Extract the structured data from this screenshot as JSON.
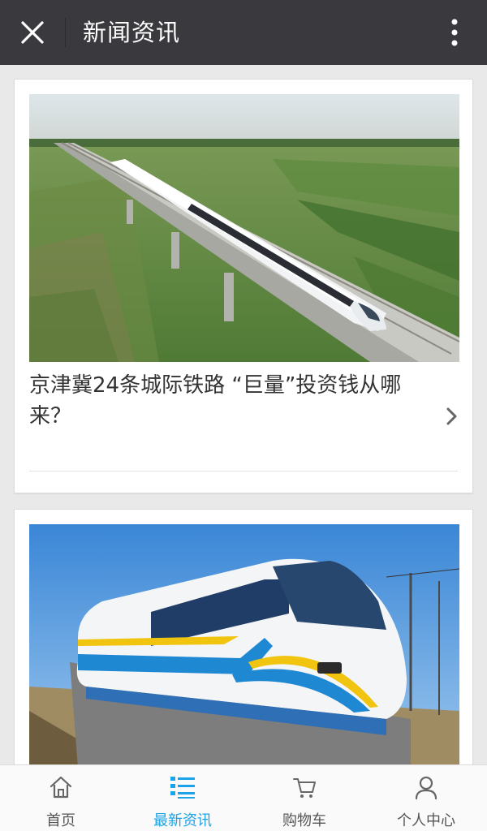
{
  "header": {
    "title": "新闻资讯",
    "close_icon": "close-icon",
    "more_icon": "more-vertical-icon"
  },
  "articles": [
    {
      "title": "京津冀24条城际铁路 “巨量”投资钱从哪来？",
      "image": "high-speed-train-on-viaduct-photo",
      "arrow_icon": "chevron-right-icon"
    },
    {
      "title": "",
      "image": "maglev-train-photo"
    }
  ],
  "tabs": [
    {
      "label": "首页",
      "icon": "home-icon",
      "active": false
    },
    {
      "label": "最新资讯",
      "icon": "news-list-icon",
      "active": true
    },
    {
      "label": "购物车",
      "icon": "cart-icon",
      "active": false
    },
    {
      "label": "个人中心",
      "icon": "user-icon",
      "active": false
    }
  ],
  "colors": {
    "header_bg": "#3a3a3e",
    "page_bg": "#e9e9e9",
    "accent": "#1aa3e8",
    "tab_text": "#555555"
  }
}
